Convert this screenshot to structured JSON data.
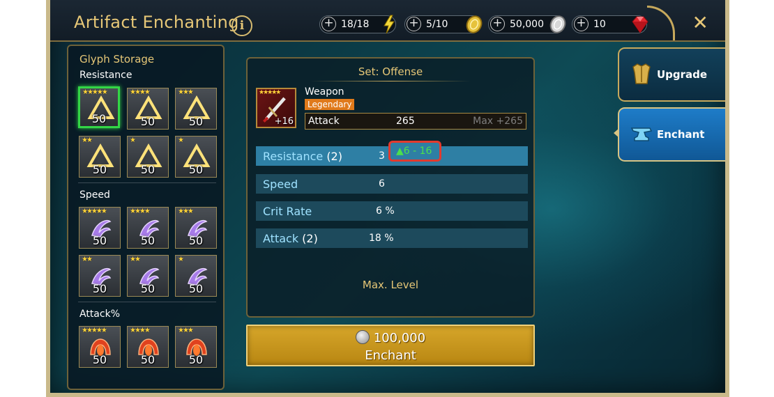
{
  "header": {
    "title": "Artifact Enchanting",
    "info_label": "i",
    "close_label": "✕",
    "resources": [
      {
        "value": "18/18",
        "icon": "energy-bolt-icon",
        "color": "#f2d83a"
      },
      {
        "value": "5/10",
        "icon": "gold-coin-icon",
        "color": "#e6c23c"
      },
      {
        "value": "50,000",
        "icon": "silver-coin-icon",
        "color": "#cfcfcf"
      },
      {
        "value": "10",
        "icon": "ruby-gem-icon",
        "color": "#e3252d"
      }
    ],
    "plus_label": "+"
  },
  "storage": {
    "title": "Glyph Storage",
    "sections": [
      {
        "label": "Resistance",
        "glyphs": [
          {
            "stars": "★★★★★",
            "count": "50"
          },
          {
            "stars": "★★★★",
            "count": "50"
          },
          {
            "stars": "★★★",
            "count": "50"
          },
          {
            "stars": "★★",
            "count": "50"
          },
          {
            "stars": "★",
            "count": "50"
          },
          {
            "stars": "★",
            "count": "50"
          }
        ]
      },
      {
        "label": "Speed",
        "glyphs": [
          {
            "stars": "★★★★★",
            "count": "50"
          },
          {
            "stars": "★★★★",
            "count": "50"
          },
          {
            "stars": "★★★",
            "count": "50"
          },
          {
            "stars": "★★",
            "count": "50"
          },
          {
            "stars": "★★",
            "count": "50"
          },
          {
            "stars": "★",
            "count": "50"
          }
        ]
      },
      {
        "label": "Attack%",
        "glyphs": [
          {
            "stars": "★★★★★",
            "count": "50"
          },
          {
            "stars": "★★★★",
            "count": "50"
          },
          {
            "stars": "★★★",
            "count": "50"
          }
        ]
      }
    ]
  },
  "artifact": {
    "set_title": "Set: Offense",
    "name": "Weapon",
    "rarity": "Legendary",
    "stars": "★★★★★",
    "level": "+16",
    "main_stat": {
      "label": "Attack",
      "value": "265",
      "max": "Max +265"
    },
    "substats": [
      {
        "label": "Resistance",
        "count": "(2)",
        "value": "3",
        "roll": "▲6 - 16"
      },
      {
        "label": "Speed",
        "count": "",
        "value": "6"
      },
      {
        "label": "Crit Rate",
        "count": "",
        "value": "6 %"
      },
      {
        "label": "Attack",
        "count": "(2)",
        "value": "18 %"
      }
    ],
    "max_level": "Max. Level"
  },
  "enchant_button": {
    "cost": "100,000",
    "label": "Enchant"
  },
  "tabs": [
    {
      "label": "Upgrade",
      "icon": "armor-icon"
    },
    {
      "label": "Enchant",
      "icon": "anvil-icon"
    }
  ],
  "colors": {
    "accent_gold": "#e6c777",
    "selected_green": "#33d646",
    "highlight_red": "#e33a2e",
    "active_tab_blue": "#1e7cc8"
  }
}
